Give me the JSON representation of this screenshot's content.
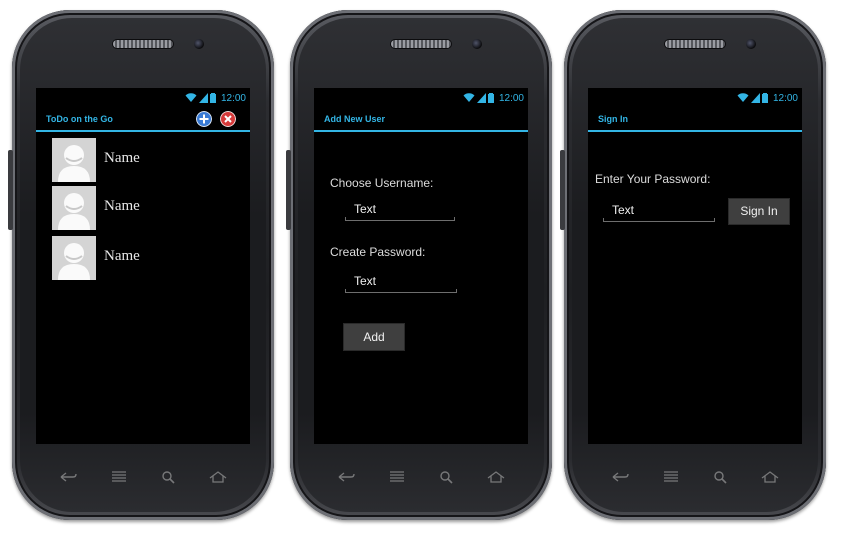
{
  "status_bar": {
    "time": "12:00"
  },
  "screens": {
    "todo": {
      "title": "ToDo on the Go",
      "actions": {
        "add": "add-icon",
        "close": "close-icon"
      },
      "users": [
        {
          "name": "Name"
        },
        {
          "name": "Name"
        },
        {
          "name": "Name"
        }
      ]
    },
    "add_user": {
      "title": "Add New User",
      "username_label": "Choose Username:",
      "username_value": "Text",
      "password_label": "Create Password:",
      "password_value": "Text",
      "add_button": "Add"
    },
    "sign_in": {
      "title": "Sign In",
      "password_label": "Enter Your Password:",
      "password_value": "Text",
      "sign_in_button": "Sign In"
    }
  },
  "softkeys": [
    "back-icon",
    "menu-icon",
    "search-icon",
    "home-icon"
  ],
  "colors": {
    "accent": "#33b5e5",
    "screen_bg": "#000000",
    "button_bg": "#3f3f3f"
  }
}
